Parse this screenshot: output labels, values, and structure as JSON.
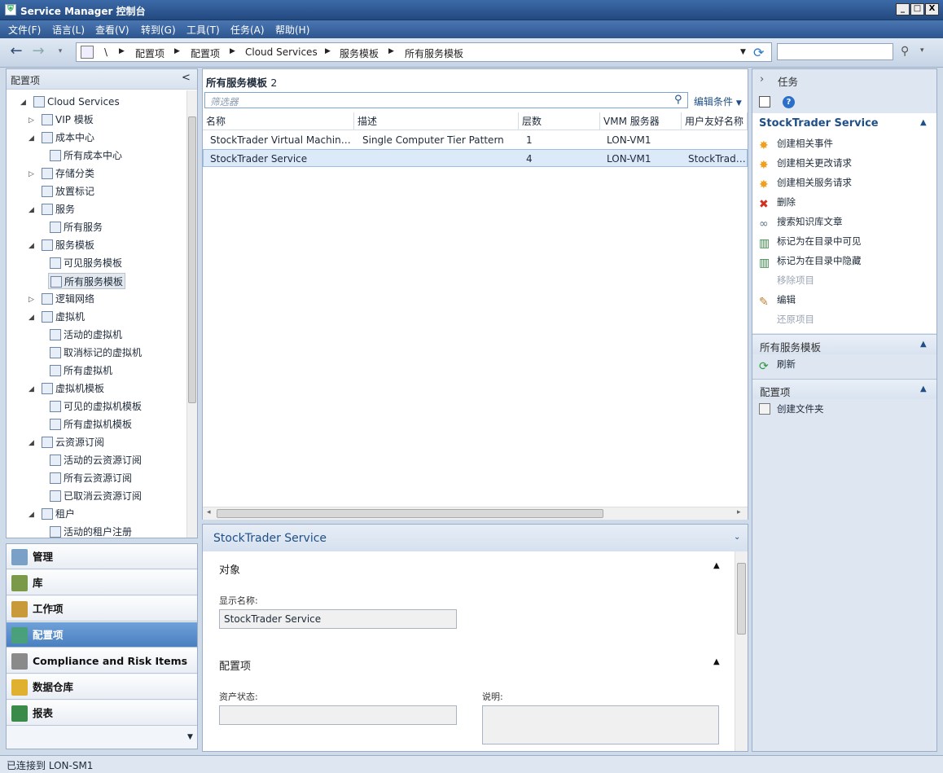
{
  "window": {
    "title": "Service Manager 控制台",
    "min": "_",
    "max": "□",
    "close": "X"
  },
  "menu": [
    "文件(F)",
    "语言(L)",
    "查看(V)",
    "转到(G)",
    "工具(T)",
    "任务(A)",
    "帮助(H)"
  ],
  "breadcrumb": [
    "\\",
    "配置项",
    "配置项",
    "Cloud Services",
    "服务模板",
    "所有服务模板"
  ],
  "left": {
    "title": "配置项",
    "collapse": "<",
    "tree": [
      {
        "label": "Cloud Services",
        "level": 0,
        "exp": "◢"
      },
      {
        "label": "VIP 模板",
        "level": 1,
        "exp": "▷"
      },
      {
        "label": "成本中心",
        "level": 1,
        "exp": "◢"
      },
      {
        "label": "所有成本中心",
        "level": 2,
        "exp": ""
      },
      {
        "label": "存储分类",
        "level": 1,
        "exp": "▷"
      },
      {
        "label": "放置标记",
        "level": 1,
        "exp": ""
      },
      {
        "label": "服务",
        "level": 1,
        "exp": "◢"
      },
      {
        "label": "所有服务",
        "level": 2,
        "exp": ""
      },
      {
        "label": "服务模板",
        "level": 1,
        "exp": "◢"
      },
      {
        "label": "可见服务模板",
        "level": 2,
        "exp": ""
      },
      {
        "label": "所有服务模板",
        "level": 2,
        "exp": "",
        "sel": true
      },
      {
        "label": "逻辑网络",
        "level": 1,
        "exp": "▷"
      },
      {
        "label": "虚拟机",
        "level": 1,
        "exp": "◢"
      },
      {
        "label": "活动的虚拟机",
        "level": 2,
        "exp": ""
      },
      {
        "label": "取消标记的虚拟机",
        "level": 2,
        "exp": ""
      },
      {
        "label": "所有虚拟机",
        "level": 2,
        "exp": ""
      },
      {
        "label": "虚拟机模板",
        "level": 1,
        "exp": "◢"
      },
      {
        "label": "可见的虚拟机模板",
        "level": 2,
        "exp": ""
      },
      {
        "label": "所有虚拟机模板",
        "level": 2,
        "exp": ""
      },
      {
        "label": "云资源订阅",
        "level": 1,
        "exp": "◢"
      },
      {
        "label": "活动的云资源订阅",
        "level": 2,
        "exp": ""
      },
      {
        "label": "所有云资源订阅",
        "level": 2,
        "exp": ""
      },
      {
        "label": "已取消云资源订阅",
        "level": 2,
        "exp": ""
      },
      {
        "label": "租户",
        "level": 1,
        "exp": "◢"
      },
      {
        "label": "活动的租户注册",
        "level": 2,
        "exp": ""
      }
    ]
  },
  "wunderbar": [
    {
      "label": "管理",
      "color": "#7aa0c8"
    },
    {
      "label": "库",
      "color": "#7a9a4a"
    },
    {
      "label": "工作项",
      "color": "#c89a3a"
    },
    {
      "label": "配置项",
      "color": "#4aa07a",
      "sel": true
    },
    {
      "label": "Compliance and Risk Items",
      "color": "#8a8a8a"
    },
    {
      "label": "数据仓库",
      "color": "#e0b030"
    },
    {
      "label": "报表",
      "color": "#3a8a4a"
    }
  ],
  "list": {
    "title": "所有服务模板",
    "count": "2",
    "filter_placeholder": "筛选器",
    "edit_criteria": "编辑条件",
    "columns": [
      "名称",
      "描述",
      "层数",
      "VMM 服务器",
      "用户友好名称"
    ],
    "rows": [
      [
        "StockTrader Virtual Machine...",
        "Single Computer Tier Pattern",
        "1",
        "LON-VM1",
        ""
      ],
      [
        "StockTrader Service",
        "",
        "4",
        "LON-VM1",
        "StockTrader..."
      ]
    ]
  },
  "detail": {
    "title": "StockTrader Service",
    "section1": "对象",
    "display_name_label": "显示名称:",
    "display_name": "StockTrader Service",
    "section2": "配置项",
    "asset_status_label": "资产状态:",
    "description_label": "说明:"
  },
  "tasks": {
    "header": "任务",
    "section_title": "StockTrader Service",
    "items": [
      {
        "label": "创建相关事件",
        "icon": "star-icon",
        "color": "#f0a020"
      },
      {
        "label": "创建相关更改请求",
        "icon": "star-icon",
        "color": "#f0a020"
      },
      {
        "label": "创建相关服务请求",
        "icon": "star-icon",
        "color": "#f0a020"
      },
      {
        "label": "删除",
        "icon": "delete-icon",
        "color": "#d03020"
      },
      {
        "label": "搜索知识库文章",
        "icon": "link-icon",
        "color": "#6a7a8a"
      },
      {
        "label": "标记为在目录中可见",
        "icon": "book-icon",
        "color": "#3a8a4a"
      },
      {
        "label": "标记为在目录中隐藏",
        "icon": "book-icon",
        "color": "#3a8a4a"
      },
      {
        "label": "移除项目",
        "icon": "",
        "color": "",
        "disabled": true
      },
      {
        "label": "编辑",
        "icon": "pencil-icon",
        "color": "#c08030"
      },
      {
        "label": "还原项目",
        "icon": "",
        "color": "",
        "disabled": true
      }
    ],
    "view_section": "所有服务模板",
    "refresh": "刷新",
    "ci_section": "配置项",
    "create_folder": "创建文件夹"
  },
  "status": "已连接到 LON-SM1"
}
